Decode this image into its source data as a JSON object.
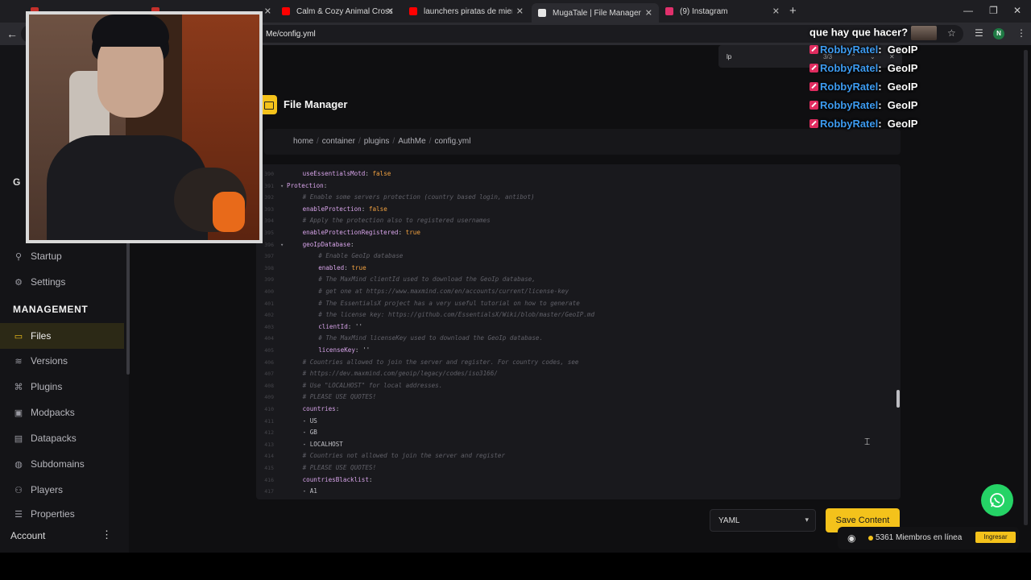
{
  "browser": {
    "tabs": [
      {
        "label": "",
        "favicon": "#c4302b"
      },
      {
        "label": "",
        "favicon": "#c4302b"
      },
      {
        "label": "Calm & Cozy Animal Crossing",
        "favicon": "#ff0000"
      },
      {
        "label": "launchers piratas de mienccraf",
        "favicon": "#ff0000"
      },
      {
        "label": "MugaTale | File Manager",
        "favicon": "#e6e6e6"
      },
      {
        "label": "(9) Instagram",
        "favicon": "#e1306c"
      }
    ],
    "url": "Me/config.yml",
    "new_tab": "+",
    "profile_initial": "N"
  },
  "find_bar": {
    "query": "lp",
    "count": "3/3"
  },
  "sidebar": {
    "items_top": [
      {
        "label": "Startup",
        "icon": "startup-icon"
      },
      {
        "label": "Settings",
        "icon": "gear-icon"
      }
    ],
    "section_heading": "MANAGEMENT",
    "items": [
      {
        "label": "Files",
        "icon": "folder-icon",
        "active": true
      },
      {
        "label": "Versions",
        "icon": "layers-icon"
      },
      {
        "label": "Plugins",
        "icon": "plugin-icon"
      },
      {
        "label": "Modpacks",
        "icon": "box-icon"
      },
      {
        "label": "Datapacks",
        "icon": "stack-icon"
      },
      {
        "label": "Subdomains",
        "icon": "globe-icon"
      },
      {
        "label": "Players",
        "icon": "players-icon"
      },
      {
        "label": "Properties",
        "icon": "list-icon"
      }
    ],
    "partial_letter": "G",
    "account_label": "Account",
    "account_menu": "⋮"
  },
  "file_manager": {
    "title": "File Manager",
    "breadcrumb": [
      "home",
      "container",
      "plugins",
      "AuthMe",
      "config.yml"
    ]
  },
  "editor": {
    "lines": [
      {
        "n": "390",
        "indent": 2,
        "type": "kv",
        "key": "useEssentialsMotd",
        "val": "false"
      },
      {
        "n": "391",
        "indent": 0,
        "type": "key",
        "key": "Protection",
        "fold": true
      },
      {
        "n": "392",
        "indent": 2,
        "type": "comment",
        "text": "# Enable some servers protection (country based login, antibot)"
      },
      {
        "n": "393",
        "indent": 2,
        "type": "kv",
        "key": "enableProtection",
        "val": "false"
      },
      {
        "n": "394",
        "indent": 2,
        "type": "comment",
        "text": "# Apply the protection also to registered usernames"
      },
      {
        "n": "395",
        "indent": 2,
        "type": "kv",
        "key": "enableProtectionRegistered",
        "val": "true"
      },
      {
        "n": "396",
        "indent": 2,
        "type": "key",
        "key": "geoIpDatabase",
        "fold": true
      },
      {
        "n": "397",
        "indent": 4,
        "type": "comment",
        "text": "# Enable GeoIp database"
      },
      {
        "n": "398",
        "indent": 4,
        "type": "kv",
        "key": "enabled",
        "val": "true"
      },
      {
        "n": "399",
        "indent": 4,
        "type": "comment",
        "text": "# The MaxMind clientId used to download the GeoIp database,"
      },
      {
        "n": "400",
        "indent": 4,
        "type": "comment",
        "text": "# get one at https://www.maxmind.com/en/accounts/current/license-key"
      },
      {
        "n": "401",
        "indent": 4,
        "type": "comment",
        "text": "# The EssentialsX project has a very useful tutorial on how to generate"
      },
      {
        "n": "402",
        "indent": 4,
        "type": "comment",
        "text": "# the license key: https://github.com/EssentialsX/Wiki/blob/master/GeoIP.md"
      },
      {
        "n": "403",
        "indent": 4,
        "type": "kvs",
        "key": "clientId",
        "val": "''"
      },
      {
        "n": "404",
        "indent": 4,
        "type": "comment",
        "text": "# The MaxMind licenseKey used to download the GeoIp database."
      },
      {
        "n": "405",
        "indent": 4,
        "type": "kvs",
        "key": "licenseKey",
        "val": "''"
      },
      {
        "n": "406",
        "indent": 2,
        "type": "comment",
        "text": "# Countries allowed to join the server and register. For country codes, see"
      },
      {
        "n": "407",
        "indent": 2,
        "type": "comment",
        "text": "# https://dev.maxmind.com/geoip/legacy/codes/iso3166/"
      },
      {
        "n": "408",
        "indent": 2,
        "type": "comment",
        "text": "# Use \"LOCALHOST\" for local addresses."
      },
      {
        "n": "409",
        "indent": 2,
        "type": "comment",
        "text": "# PLEASE USE QUOTES!"
      },
      {
        "n": "410",
        "indent": 2,
        "type": "key",
        "key": "countries"
      },
      {
        "n": "411",
        "indent": 2,
        "type": "item",
        "text": "- US"
      },
      {
        "n": "412",
        "indent": 2,
        "type": "item",
        "text": "- GB"
      },
      {
        "n": "413",
        "indent": 2,
        "type": "item",
        "text": "- LOCALHOST"
      },
      {
        "n": "414",
        "indent": 2,
        "type": "comment",
        "text": "# Countries not allowed to join the server and register"
      },
      {
        "n": "415",
        "indent": 2,
        "type": "comment",
        "text": "# PLEASE USE QUOTES!"
      },
      {
        "n": "416",
        "indent": 2,
        "type": "key",
        "key": "countriesBlacklist"
      },
      {
        "n": "417",
        "indent": 2,
        "type": "item",
        "text": "- A1"
      }
    ]
  },
  "footer": {
    "language_select": "YAML",
    "save_label": "Save Content"
  },
  "discord_widget": {
    "members_text": "5361 Miembros en línea",
    "join_label": "Ingresar"
  },
  "chat": {
    "top_line": "que hay que hacer?",
    "messages": [
      {
        "user": "RobbyRatel",
        "text": "GeoIP"
      },
      {
        "user": "RobbyRatel",
        "text": "GeoIP"
      },
      {
        "user": "RobbyRatel",
        "text": "GeoIP"
      },
      {
        "user": "RobbyRatel",
        "text": "GeoIP"
      },
      {
        "user": "RobbyRatel",
        "text": "GeoIP"
      }
    ],
    "badge_color": "#e02c5f",
    "user_color": "#3d9bf0"
  },
  "colors": {
    "accent": "#f4c21b",
    "whatsapp": "#25d366"
  }
}
